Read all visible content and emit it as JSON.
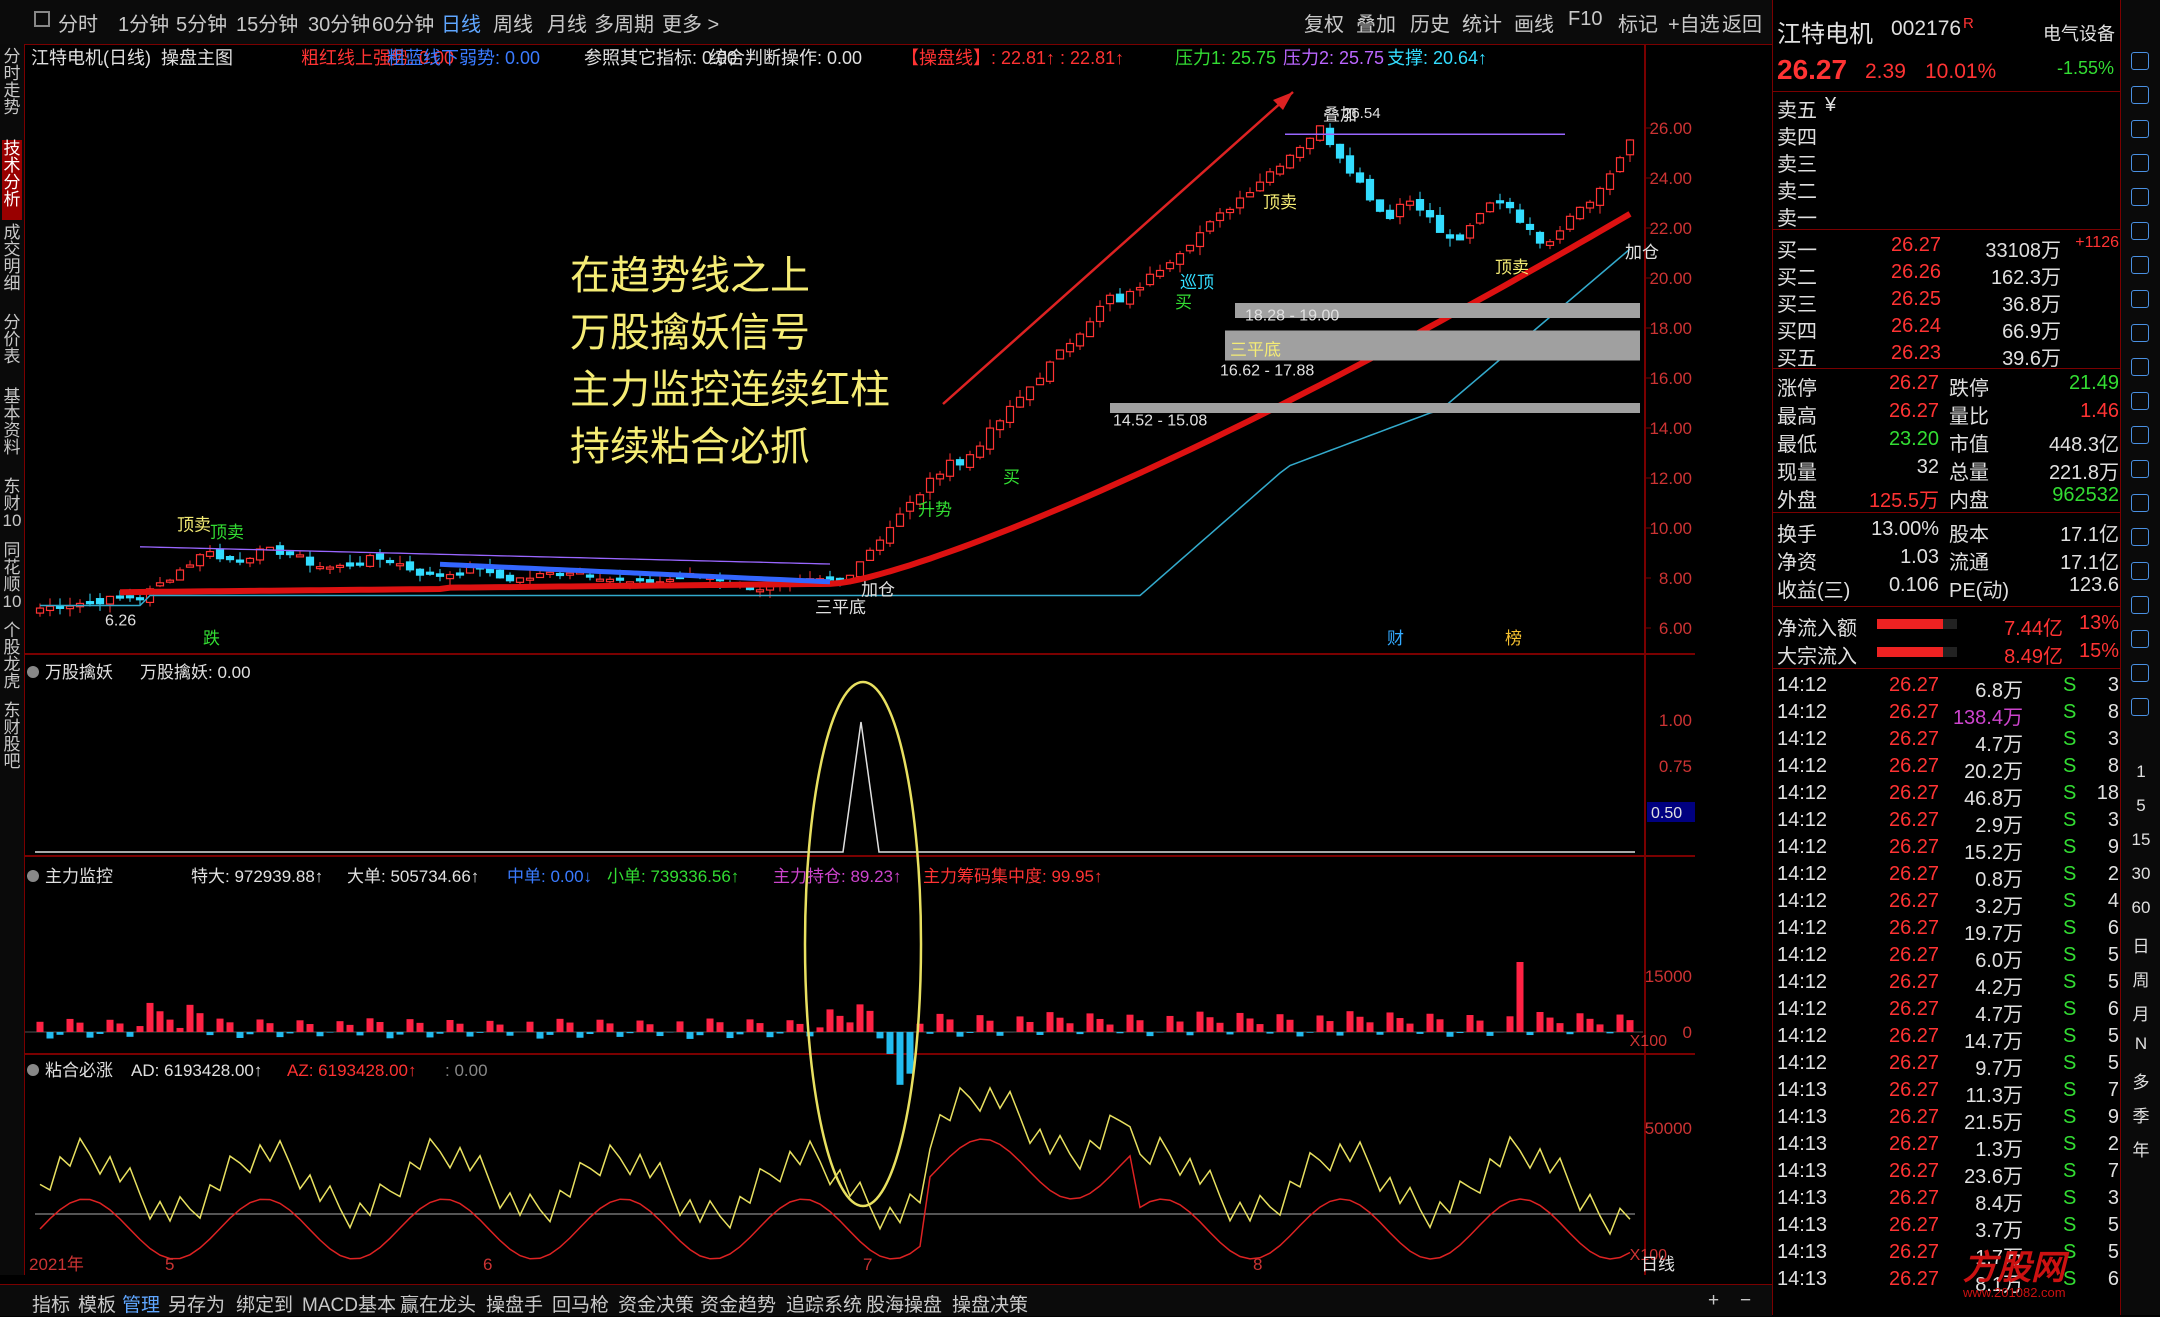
{
  "top_tabs": [
    "分时",
    "1分钟",
    "5分钟",
    "15分钟",
    "30分钟",
    "60分钟",
    "日线",
    "周线",
    "月线",
    "多周期",
    "更多 >"
  ],
  "top_active": "日线",
  "top_right_tabs": [
    "复权",
    "叠加",
    "历史",
    "统计",
    "画线",
    "F10",
    "标记",
    "+自选",
    "返回"
  ],
  "left_tabs": [
    "分时走势",
    "技术分析",
    "成交明细",
    "分价表",
    "基本资料",
    "东财10",
    "同花顺10",
    "个股龙虎",
    "东财股吧"
  ],
  "left_active": "技术分析",
  "main_header": {
    "stock": "江特电机(日线)",
    "indicator": "操盘主图",
    "items": [
      {
        "t": "粗红线上强势: 0.00",
        "c": "#ff3333"
      },
      {
        "t": "粗蓝线下弱势: 0.00",
        "c": "#3a7bff"
      },
      {
        "t": "参照其它指标: 0.00",
        "c": "#e0e0e0"
      },
      {
        "t": "综合判断操作: 0.00",
        "c": "#e0e0e0"
      },
      {
        "t": "【操盘线】: 22.81↑ : 22.81↑",
        "c": "#ff3333"
      },
      {
        "t": "压力1: 25.75",
        "c": "#33dd33"
      },
      {
        "t": "压力2: 25.75",
        "c": "#bb66ff"
      },
      {
        "t": "支撑: 20.64↑",
        "c": "#33ddff"
      }
    ]
  },
  "annotation_lines": [
    "在趋势线之上",
    "万股擒妖信号",
    "主力监控连续红柱",
    "持续粘合必抓"
  ],
  "price_axis": [
    "26.00",
    "24.00",
    "22.00",
    "20.00",
    "18.00",
    "16.00",
    "14.00",
    "12.00",
    "10.00",
    "8.00",
    "6.00"
  ],
  "price_labels": {
    "low": "6.26",
    "high": "26.54",
    "zones": [
      "18.28 - 19.00",
      "16.62 - 17.88",
      "14.52 - 15.08"
    ],
    "signals": [
      "顶卖",
      "顶卖",
      "加仓",
      "加仓",
      "三平底",
      "三平底",
      "顶卖",
      "升势",
      "买",
      "买",
      "顶卖",
      "巡顶",
      "叠加"
    ],
    "flags": [
      "跌",
      "财",
      "榜"
    ]
  },
  "pane2": {
    "title": "万股擒妖",
    "value": "万股擒妖: 0.00",
    "axis": [
      "1.00",
      "0.75",
      "0.50"
    ],
    "marker": "0.50"
  },
  "pane3": {
    "title": "主力监控",
    "items": [
      {
        "t": "特大: 972939.88↑",
        "c": "#e0e0e0"
      },
      {
        "t": "大单: 505734.66↑",
        "c": "#e0e0e0"
      },
      {
        "t": "中单: 0.00↓",
        "c": "#3a7bff"
      },
      {
        "t": "小单: 739336.56↑",
        "c": "#33dd33"
      },
      {
        "t": "主力持仓: 89.23↑",
        "c": "#cc44cc"
      },
      {
        "t": "主力筹码集中度: 99.95↑",
        "c": "#ff3333"
      }
    ],
    "axis": [
      "15000",
      "0"
    ],
    "unit": "X100"
  },
  "pane4": {
    "title": "粘合必涨",
    "items": [
      {
        "t": "AD: 6193428.00↑",
        "c": "#e0e0e0"
      },
      {
        "t": "AZ: 6193428.00↑",
        "c": "#ff3333"
      },
      {
        "t": ": 0.00",
        "c": "#888888"
      }
    ],
    "axis": [
      "50000"
    ],
    "unit": "X100"
  },
  "date_axis": [
    "2021年",
    "5",
    "6",
    "7",
    "8"
  ],
  "period_label": "日线",
  "bottom_tabs": [
    "指标",
    "模板",
    "管理",
    "另存为",
    "绑定到",
    "MACD基本",
    "赢在龙头",
    "操盘手",
    "回马枪",
    "资金决策",
    "资金趋势",
    "追踪系统",
    "股海操盘",
    "操盘决策"
  ],
  "bottom_active": "管理",
  "quote": {
    "name": "江特电机",
    "code": "002176",
    "mark": "R",
    "sector": "电气设备",
    "sector_pct": "-1.55%",
    "price": "26.27",
    "change": "2.39",
    "pct": "10.01%",
    "asks": [
      {
        "l": "卖五",
        "p": "¥",
        "v": ""
      },
      {
        "l": "卖四",
        "p": "",
        "v": ""
      },
      {
        "l": "卖三",
        "p": "",
        "v": ""
      },
      {
        "l": "卖二",
        "p": "",
        "v": ""
      },
      {
        "l": "卖一",
        "p": "",
        "v": ""
      }
    ],
    "bids": [
      {
        "l": "买一",
        "p": "26.27",
        "v": "33108万",
        "x": "+1126"
      },
      {
        "l": "买二",
        "p": "26.26",
        "v": "162.3万",
        "x": ""
      },
      {
        "l": "买三",
        "p": "26.25",
        "v": "36.8万",
        "x": ""
      },
      {
        "l": "买四",
        "p": "26.24",
        "v": "66.9万",
        "x": ""
      },
      {
        "l": "买五",
        "p": "26.23",
        "v": "39.6万",
        "x": ""
      }
    ],
    "stats": [
      {
        "l1": "涨停",
        "v1": "26.27",
        "c1": "#ff3333",
        "l2": "跌停",
        "v2": "21.49",
        "c2": "#33dd33"
      },
      {
        "l1": "最高",
        "v1": "26.27",
        "c1": "#ff3333",
        "l2": "量比",
        "v2": "1.46",
        "c2": "#ff3333"
      },
      {
        "l1": "最低",
        "v1": "23.20",
        "c1": "#33dd33",
        "l2": "市值",
        "v2": "448.3亿",
        "c2": "#e0e0e0"
      },
      {
        "l1": "现量",
        "v1": "32",
        "c1": "#e0e0e0",
        "l2": "总量",
        "v2": "221.8万",
        "c2": "#e0e0e0"
      },
      {
        "l1": "外盘",
        "v1": "125.5万",
        "c1": "#ff3333",
        "l2": "内盘",
        "v2": "962532",
        "c2": "#33dd33"
      }
    ],
    "stats2": [
      {
        "l1": "换手",
        "v1": "13.00%",
        "l2": "股本",
        "v2": "17.1亿"
      },
      {
        "l1": "净资",
        "v1": "1.03",
        "l2": "流通",
        "v2": "17.1亿"
      },
      {
        "l1": "收益(三)",
        "v1": "0.106",
        "l2": "PE(动)",
        "v2": "123.6"
      }
    ],
    "flows": [
      {
        "l": "净流入额",
        "v": "7.44亿",
        "p": "13%",
        "fill": 0.82
      },
      {
        "l": "大宗流入",
        "v": "8.49亿",
        "p": "15%",
        "fill": 0.82
      }
    ],
    "ticks": [
      {
        "t": "14:12",
        "p": "26.27",
        "v": "6.8万",
        "c": "#e0e0e0",
        "n": "3"
      },
      {
        "t": "14:12",
        "p": "26.27",
        "v": "138.4万",
        "c": "#cc44cc",
        "n": "8"
      },
      {
        "t": "14:12",
        "p": "26.27",
        "v": "4.7万",
        "c": "#e0e0e0",
        "n": "3"
      },
      {
        "t": "14:12",
        "p": "26.27",
        "v": "20.2万",
        "c": "#e0e0e0",
        "n": "8"
      },
      {
        "t": "14:12",
        "p": "26.27",
        "v": "46.8万",
        "c": "#e0e0e0",
        "n": "18"
      },
      {
        "t": "14:12",
        "p": "26.27",
        "v": "2.9万",
        "c": "#e0e0e0",
        "n": "3"
      },
      {
        "t": "14:12",
        "p": "26.27",
        "v": "15.2万",
        "c": "#e0e0e0",
        "n": "9"
      },
      {
        "t": "14:12",
        "p": "26.27",
        "v": "0.8万",
        "c": "#e0e0e0",
        "n": "2"
      },
      {
        "t": "14:12",
        "p": "26.27",
        "v": "3.2万",
        "c": "#e0e0e0",
        "n": "4"
      },
      {
        "t": "14:12",
        "p": "26.27",
        "v": "19.7万",
        "c": "#e0e0e0",
        "n": "6"
      },
      {
        "t": "14:12",
        "p": "26.27",
        "v": "6.0万",
        "c": "#e0e0e0",
        "n": "5"
      },
      {
        "t": "14:12",
        "p": "26.27",
        "v": "4.2万",
        "c": "#e0e0e0",
        "n": "5"
      },
      {
        "t": "14:12",
        "p": "26.27",
        "v": "4.7万",
        "c": "#e0e0e0",
        "n": "6"
      },
      {
        "t": "14:12",
        "p": "26.27",
        "v": "14.7万",
        "c": "#e0e0e0",
        "n": "5"
      },
      {
        "t": "14:12",
        "p": "26.27",
        "v": "9.7万",
        "c": "#e0e0e0",
        "n": "5"
      },
      {
        "t": "14:13",
        "p": "26.27",
        "v": "11.3万",
        "c": "#e0e0e0",
        "n": "7"
      },
      {
        "t": "14:13",
        "p": "26.27",
        "v": "21.5万",
        "c": "#e0e0e0",
        "n": "9"
      },
      {
        "t": "14:13",
        "p": "26.27",
        "v": "1.3万",
        "c": "#e0e0e0",
        "n": "2"
      },
      {
        "t": "14:13",
        "p": "26.27",
        "v": "23.6万",
        "c": "#e0e0e0",
        "n": "7"
      },
      {
        "t": "14:13",
        "p": "26.27",
        "v": "8.4万",
        "c": "#e0e0e0",
        "n": "3"
      },
      {
        "t": "14:13",
        "p": "26.27",
        "v": "3.7万",
        "c": "#e0e0e0",
        "n": "5"
      },
      {
        "t": "14:13",
        "p": "26.27",
        "v": "1.7万",
        "c": "#e0e0e0",
        "n": "5"
      },
      {
        "t": "14:13",
        "p": "26.27",
        "v": "8.1万",
        "c": "#e0e0e0",
        "n": "6"
      }
    ],
    "tick_side": "S"
  },
  "right_icons": [
    "up",
    "down",
    "a",
    "b",
    "c",
    "d",
    "e",
    "f",
    "g",
    "h",
    "i",
    "j",
    "k",
    "l",
    "m",
    "rsi",
    "n",
    "o",
    "p",
    "q"
  ],
  "right_icon_labels": [
    "1",
    "5",
    "15",
    "30",
    "60",
    "日",
    "周",
    "月",
    "N",
    "多",
    "季",
    "年"
  ],
  "watermark": "方股网",
  "watermark_url": "www.201082.com",
  "colors": {
    "up": "#ff3333",
    "down": "#33ddff",
    "trend": "#dd1111",
    "weak": "#3366ff",
    "support": "#33aacc",
    "ellipse": "#e8e060"
  }
}
